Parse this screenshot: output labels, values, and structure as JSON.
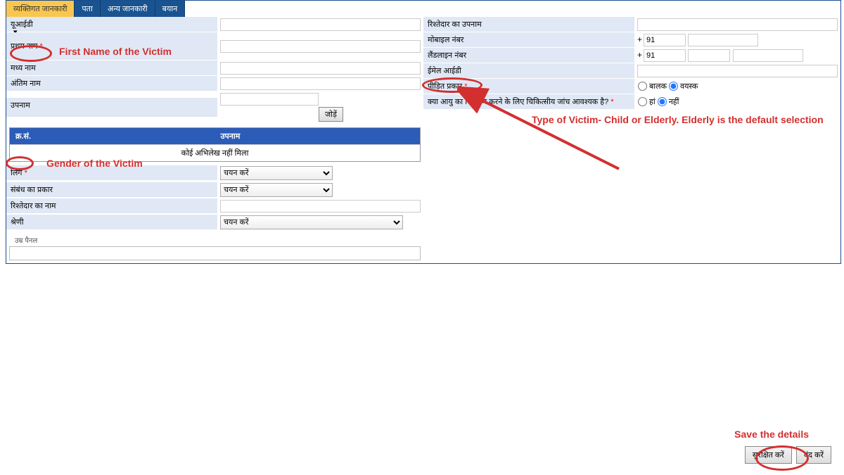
{
  "tabs": [
    "व्यक्तिगत जानकारी",
    "पता",
    "अन्य जानकारी",
    "बयान"
  ],
  "left_labels": {
    "uid": "यूआईडी",
    "first_name": "प्रथम नाम",
    "middle_name": "मध्य नाम",
    "last_name": "अंतिम नाम",
    "alias": "उपनाम",
    "gender": "लिंग",
    "relation_type": "संबंध का प्रकार",
    "relative_name": "रिश्तेदार का नाम",
    "category": "श्रेणी"
  },
  "right_labels": {
    "relative_surname": "रिश्तेदार का उपनाम",
    "mobile": "मोबाइल नंबर",
    "landline": "लैंडलाइन नंबर",
    "email": "ईमेल आईडी",
    "victim_type": "पीड़ित प्रकार",
    "age_test": "क्या आयु का निर्धारण करने के लिए चिकित्सीय जांच आवश्यक है?"
  },
  "buttons": {
    "add": "जोड़ें",
    "save": "सुरक्षित करें",
    "close": "बंद करें"
  },
  "table": {
    "col1": "क्र.सं.",
    "col2": "उपनाम",
    "empty": "कोई अभिलेख नहीं मिला"
  },
  "select_placeholder": "चयन करें",
  "country_code": "91",
  "radio": {
    "child": "बालक",
    "adult": "वयस्क",
    "yes": "हां",
    "no": "नहीं"
  },
  "panel": {
    "age": "उम्र पैनल"
  },
  "annotations": {
    "first_name": "First Name of the Victim",
    "gender": "Gender of the Victim",
    "victim_type": "Type of Victim- Child or Elderly. Elderly is the default selection",
    "save": "Save the details"
  }
}
